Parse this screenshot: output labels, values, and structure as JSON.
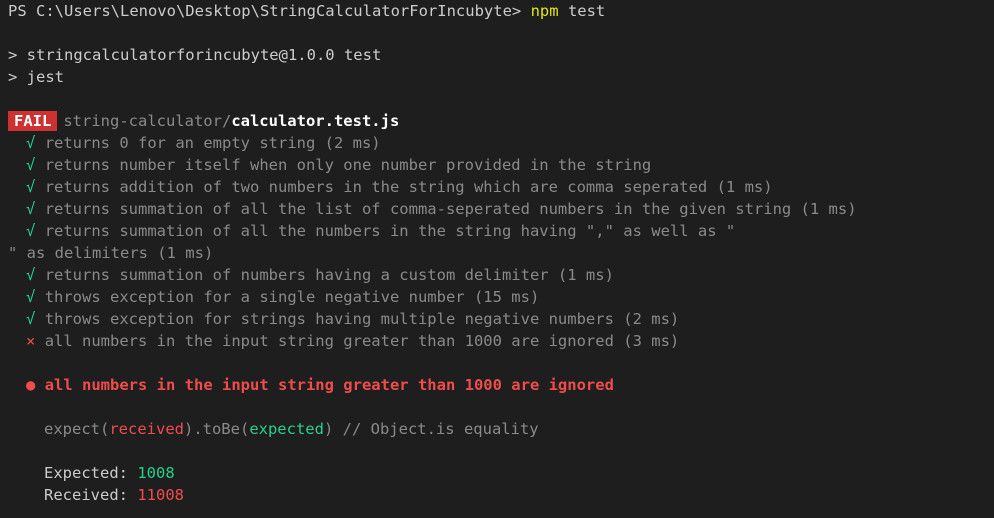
{
  "terminal": {
    "prompt": "PS C:\\Users\\Lenovo\\Desktop\\StringCalculatorForIncubyte>",
    "command": "npm test",
    "npm_line1": "> stringcalculatorforincubyte@1.0.0 test",
    "npm_line2": "> jest",
    "suite": {
      "status": "FAIL",
      "path_dir": "string-calculator/",
      "path_file": "calculator.test.js"
    },
    "tests": [
      {
        "mark": "√",
        "text": "returns 0 for an empty string (2 ms)"
      },
      {
        "mark": "√",
        "text": "returns number itself when only one number provided in the string"
      },
      {
        "mark": "√",
        "text": "returns addition of two numbers in the string which are comma seperated (1 ms)"
      },
      {
        "mark": "√",
        "text": "returns summation of all the list of comma-seperated numbers in the given string (1 ms)"
      },
      {
        "mark": "√",
        "text": "returns summation of all the numbers in the string having \",\" as well as \""
      },
      {
        "wrap": "\" as delimiters (1 ms)"
      },
      {
        "mark": "√",
        "text": "returns summation of numbers having a custom delimiter (1 ms)"
      },
      {
        "mark": "√",
        "text": "throws exception for a single negative number (15 ms)"
      },
      {
        "mark": "√",
        "text": "throws exception for strings having multiple negative numbers (2 ms)"
      },
      {
        "mark": "×",
        "text": "all numbers in the input string greater than 1000 are ignored (3 ms)"
      }
    ],
    "failure": {
      "bullet": "●",
      "title": "all numbers in the input string greater than 1000 are ignored",
      "expect_prefix": "expect(",
      "received_word": "received",
      "expect_mid": ").toBe(",
      "expected_word": "expected",
      "expect_suffix": ") // Object.is equality",
      "expected_label": "Expected:",
      "expected_value": "1008",
      "received_label": "Received:",
      "received_value": "11008"
    }
  }
}
